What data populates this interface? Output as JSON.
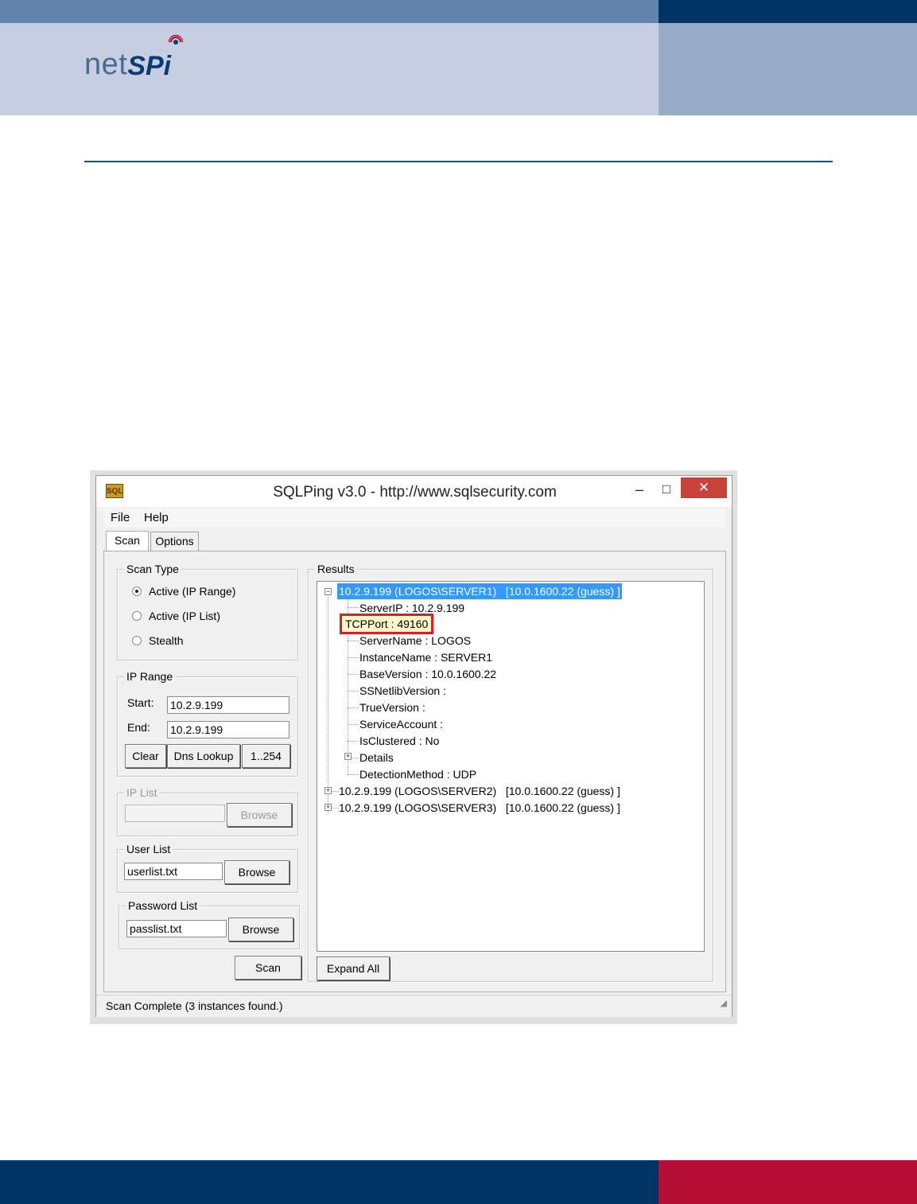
{
  "page": {
    "logo": {
      "net": "net",
      "spi": "SPi"
    }
  },
  "window": {
    "app_icon": "SQL",
    "title": "SQLPing v3.0 - http://www.sqlsecurity.com",
    "controls": {
      "minimize": "–",
      "maximize": "□",
      "close": "✕"
    },
    "menu": [
      "File",
      "Help"
    ],
    "tabs": [
      "Scan",
      "Options"
    ],
    "scan_type": {
      "title": "Scan Type",
      "options": [
        {
          "label": "Active (IP Range)",
          "checked": true
        },
        {
          "label": "Active (IP List)",
          "checked": false
        },
        {
          "label": "Stealth",
          "checked": false
        }
      ]
    },
    "ip_range": {
      "title": "IP Range",
      "start_label": "Start:",
      "start_value": "10.2.9.199",
      "end_label": "End:",
      "end_value": "10.2.9.199",
      "buttons": [
        "Clear",
        "Dns Lookup",
        "1..254"
      ]
    },
    "ip_list": {
      "title": "IP List",
      "value": "",
      "browse": "Browse"
    },
    "user_list": {
      "title": "User List",
      "value": "userlist.txt",
      "browse": "Browse"
    },
    "password_list": {
      "title": "Password List",
      "value": "passlist.txt",
      "browse": "Browse"
    },
    "scan_button": "Scan",
    "results": {
      "title": "Results",
      "root1": "10.2.9.199 (LOGOS\\SERVER1)   [10.0.1600.22 (guess) ]",
      "children": [
        "ServerIP : 10.2.9.199",
        "TCPPort : 49160",
        "ServerName : LOGOS",
        "InstanceName : SERVER1",
        "BaseVersion : 10.0.1600.22",
        "SSNetlibVersion :",
        "TrueVersion :",
        "ServiceAccount :",
        "IsClustered : No",
        "Details",
        "DetectionMethod : UDP"
      ],
      "root2": "10.2.9.199 (LOGOS\\SERVER2)   [10.0.1600.22 (guess) ]",
      "root3": "10.2.9.199 (LOGOS\\SERVER3)   [10.0.1600.22 (guess) ]",
      "expand_all": "Expand All"
    },
    "status": "Scan Complete (3 instances found.)"
  }
}
